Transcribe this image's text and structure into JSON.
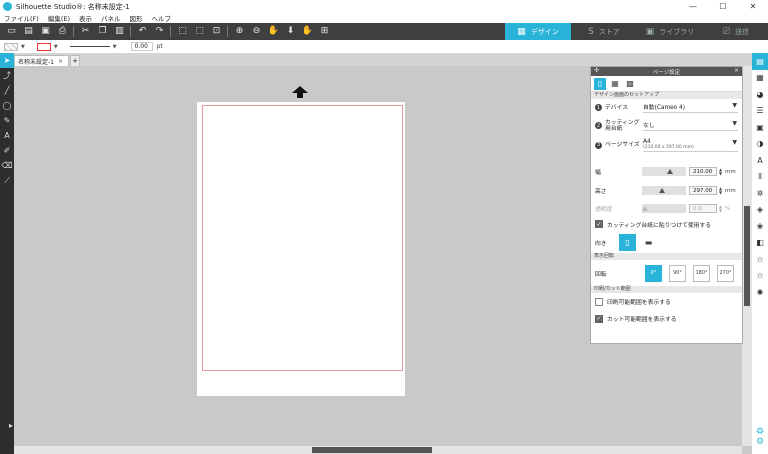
{
  "window": {
    "title": "Silhouette Studio®: 名称未設定-1",
    "controls": {
      "minimize": "—",
      "maximize": "☐",
      "close": "✕"
    }
  },
  "menu": [
    "ファイル(F)",
    "編集(E)",
    "表示",
    "パネル",
    "図形",
    "ヘルプ"
  ],
  "toolbar": {
    "icons": [
      "new-icon",
      "open-icon",
      "save-icon",
      "print-icon",
      "cut-icon",
      "copy-icon",
      "paste-icon",
      "undo-icon",
      "redo-icon",
      "select-all-icon",
      "deselect-icon",
      "zoom-area-icon",
      "zoom-in-icon",
      "zoom-out-icon",
      "zoom-drag-icon",
      "fit-page-icon",
      "pan-icon",
      "add-page-icon"
    ]
  },
  "nav_tabs": [
    {
      "label": "デザイン",
      "icon": "design-icon",
      "active": true
    },
    {
      "label": "ストア",
      "icon": "store-icon",
      "active": false
    },
    {
      "label": "ライブラリ",
      "icon": "library-icon",
      "active": false
    },
    {
      "label": "送信",
      "icon": "send-icon",
      "active": false
    }
  ],
  "line_options": {
    "value": "0.00",
    "unit": "pt"
  },
  "doc_tab": {
    "label": "名称未設定-1",
    "close": "×",
    "add": "+"
  },
  "colors": {
    "accent": "#29b3d8",
    "toolbar_bg": "#3f3f3f",
    "canvas_bg": "#c9c9c9",
    "cut_border": "#e89aa0"
  },
  "panel": {
    "title": "ページ設定",
    "grip": "✣",
    "close": "×",
    "section_setup": "デザイン画面のセットアップ",
    "device": {
      "num": "1",
      "label": "デバイス",
      "value": "自動(Cameo 4)"
    },
    "mat": {
      "num": "2",
      "label": "カッティング用台紙",
      "value": "なし"
    },
    "page_size": {
      "num": "3",
      "label": "ページサイズ",
      "value": "A4",
      "sub": "(210.00 x 297.00 mm)"
    },
    "width": {
      "label": "幅",
      "value": "210.00",
      "unit": "mm"
    },
    "height": {
      "label": "高さ",
      "value": "297.00",
      "unit": "mm"
    },
    "transparency": {
      "label": "透明度",
      "value": "0.0",
      "unit": "%"
    },
    "use_mat_label": "カッティング台紙に貼りつけて使用する",
    "orientation_label": "向き",
    "section_view": "表示回転",
    "rotation_label": "回転",
    "rotations": [
      "0°",
      "90°",
      "180°",
      "270°"
    ],
    "section_print_cut": "印刷/カット範囲",
    "show_print_label": "印刷可能範囲を表示する",
    "show_cut_label": "カット可能範囲を表示する"
  }
}
